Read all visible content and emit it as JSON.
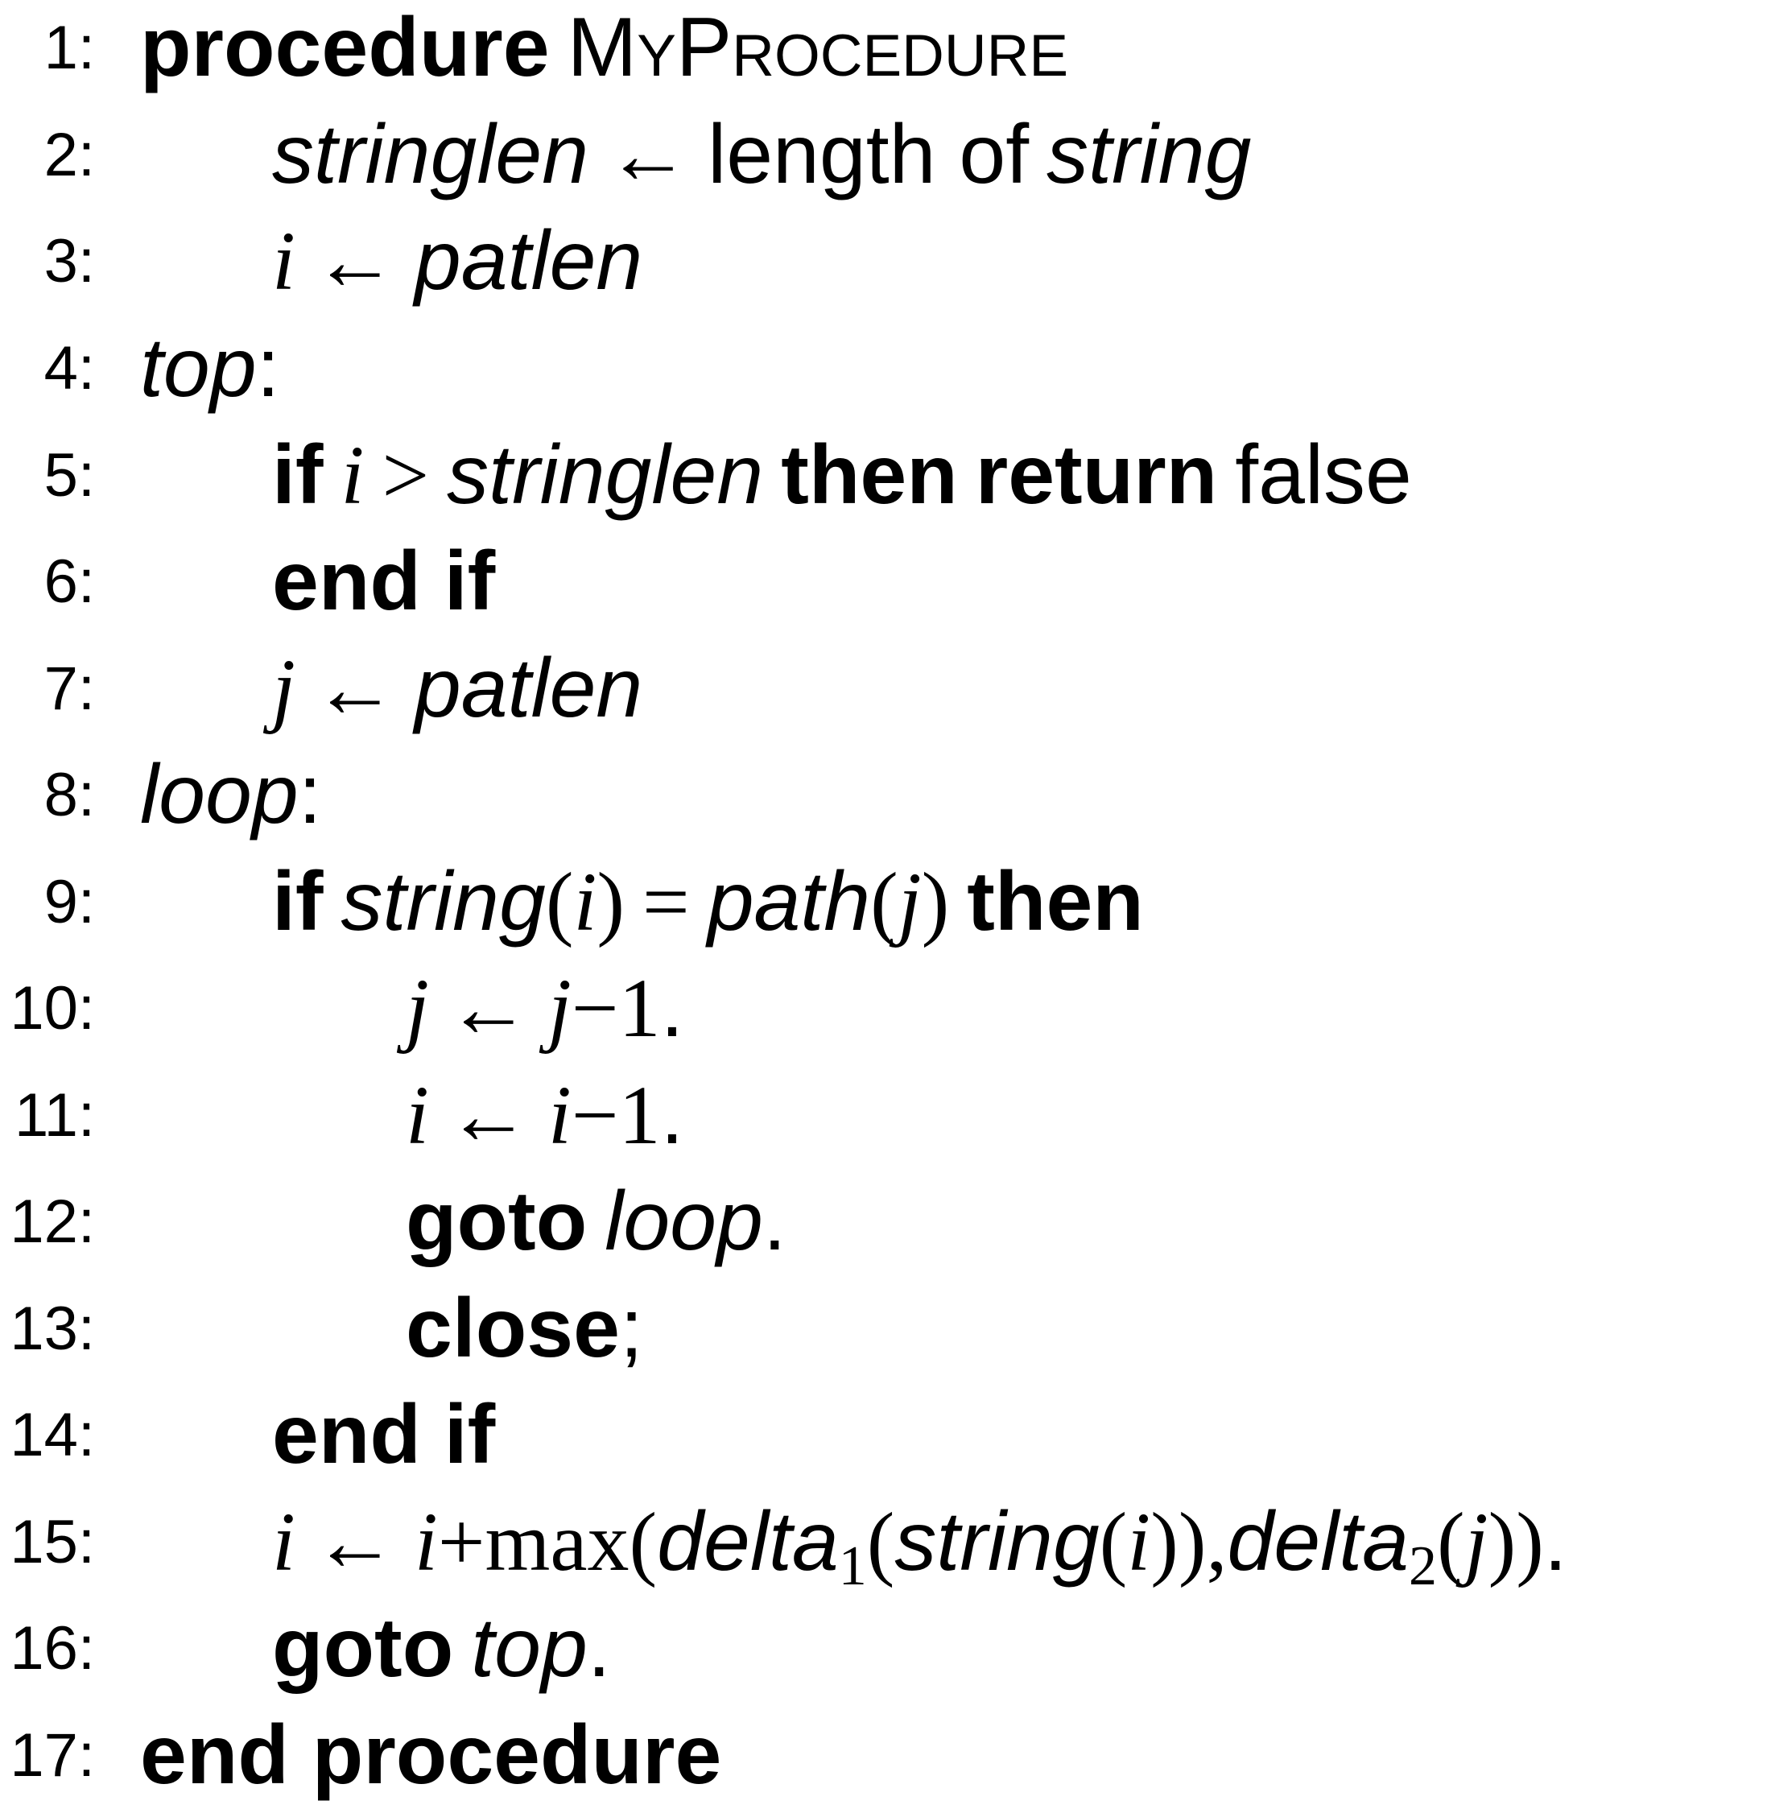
{
  "line_numbers": [
    "1:",
    "2:",
    "3:",
    "4:",
    "5:",
    "6:",
    "7:",
    "8:",
    "9:",
    "10:",
    "11:",
    "12:",
    "13:",
    "14:",
    "15:",
    "16:",
    "17:"
  ],
  "tokens": {
    "procedure": "procedure",
    "proc_name": "MyProcedure",
    "stringlen": "stringlen",
    "arrow": "←",
    "length_of": "length of",
    "string": "string",
    "i": "i",
    "j": "j",
    "patlen": "patlen",
    "top": "top",
    "colon": ":",
    "if": "if",
    "gt": ">",
    "then": "then",
    "return": "return",
    "false": "false",
    "end_if": "end if",
    "loop": "loop",
    "path": "path",
    "lparen": "(",
    "rparen": ")",
    "eq": "=",
    "minus": "−",
    "plus": "+",
    "one": "1",
    "period": ".",
    "goto": "goto",
    "close": "close",
    "semicolon": ";",
    "max": "max",
    "delta": "delta",
    "sub1": "1",
    "sub2": "2",
    "comma": ",",
    "end_procedure": "end procedure"
  }
}
